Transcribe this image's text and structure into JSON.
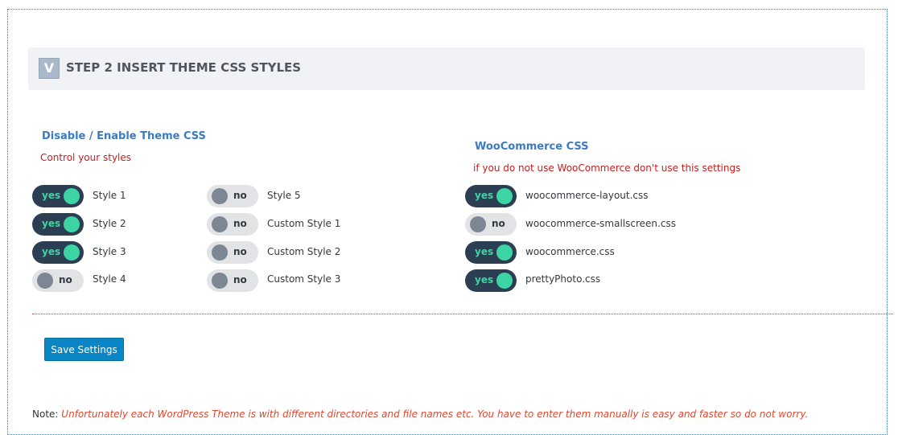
{
  "header": {
    "badge": "V",
    "title": "STEP 2 INSERT THEME CSS STYLES"
  },
  "theme_section": {
    "title": "Disable / Enable Theme CSS",
    "subtitle": "Control your styles",
    "col1": [
      {
        "label": "Style 1",
        "state": "yes"
      },
      {
        "label": "Style 2",
        "state": "yes"
      },
      {
        "label": "Style 3",
        "state": "yes"
      },
      {
        "label": "Style 4",
        "state": "no"
      }
    ],
    "col2": [
      {
        "label": "Style 5",
        "state": "no"
      },
      {
        "label": "Custom Style 1",
        "state": "no"
      },
      {
        "label": "Custom Style 2",
        "state": "no"
      },
      {
        "label": "Custom Style 3",
        "state": "no"
      }
    ]
  },
  "woo_section": {
    "title": "WooCommerce CSS",
    "subtitle": "if you do not use WooCommerce don't use this settings",
    "items": [
      {
        "label": "woocommerce-layout.css",
        "state": "yes"
      },
      {
        "label": "woocommerce-smallscreen.css",
        "state": "no"
      },
      {
        "label": "woocommerce.css",
        "state": "yes"
      },
      {
        "label": "prettyPhoto.css",
        "state": "yes"
      }
    ]
  },
  "save_label": "Save Settings",
  "note": {
    "prefix": "Note:",
    "text": "Unfortunately each WordPress Theme is with different directories and file names etc. You have to enter them manually is easy and faster so do not worry."
  },
  "colors": {
    "toggle_on_bg": "#2c3e51",
    "toggle_on_knob": "#3ed5a4",
    "toggle_off_bg": "#e2e3e5",
    "toggle_off_knob": "#7d8793",
    "accent_blue": "#3a7bc4",
    "warning_red": "#d11a1a",
    "button_blue": "#0a86c4"
  }
}
